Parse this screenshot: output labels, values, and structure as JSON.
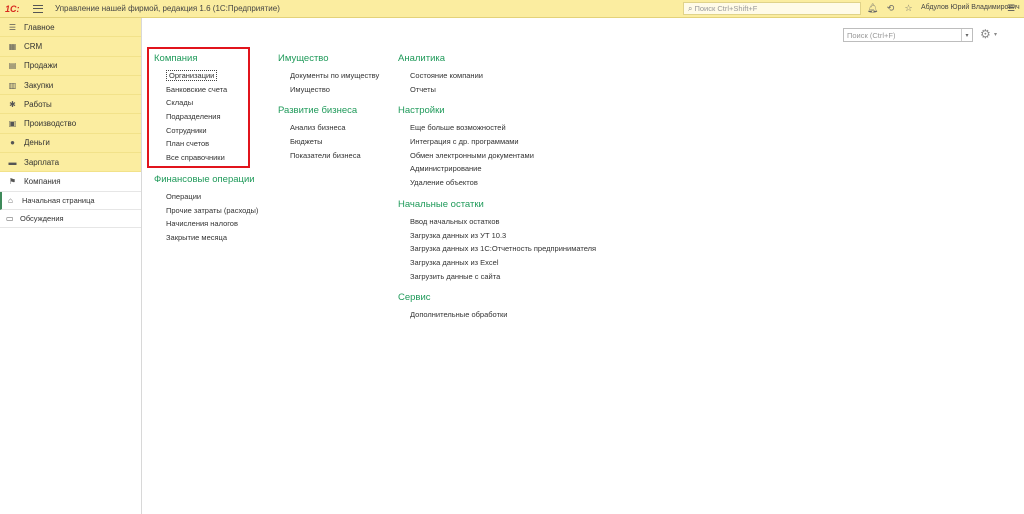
{
  "app": {
    "logo": "1С:",
    "title": "Управление нашей фирмой, редакция 1.6   (1С:Предприятие)",
    "search_placeholder": "Поиск Ctrl+Shift+F",
    "user": "Абдулов Юрий Владимирович"
  },
  "sidebar": {
    "sections": [
      {
        "label": "Главное",
        "icon": "list-icon"
      },
      {
        "label": "CRM",
        "icon": "crm-icon"
      },
      {
        "label": "Продажи",
        "icon": "sales-icon"
      },
      {
        "label": "Закупки",
        "icon": "purchases-icon"
      },
      {
        "label": "Работы",
        "icon": "works-icon"
      },
      {
        "label": "Производство",
        "icon": "production-icon"
      },
      {
        "label": "Деньги",
        "icon": "money-icon"
      },
      {
        "label": "Зарплата",
        "icon": "salary-icon"
      },
      {
        "label": "Компания",
        "icon": "flag-icon"
      }
    ],
    "open_windows": [
      {
        "label": "Начальная страница",
        "icon": "home-icon"
      },
      {
        "label": "Обсуждения",
        "icon": "chat-icon"
      }
    ]
  },
  "content": {
    "search_placeholder": "Поиск (Ctrl+F)",
    "columns": [
      {
        "groups": [
          {
            "title": "Компания",
            "links": [
              "Организации",
              "Банковские счета",
              "Склады",
              "Подразделения",
              "Сотрудники",
              "План счетов",
              "Все справочники"
            ]
          },
          {
            "title": "Финансовые операции",
            "links": [
              "Операции",
              "Прочие затраты (расходы)",
              "Начисления налогов",
              "Закрытие месяца"
            ]
          }
        ]
      },
      {
        "groups": [
          {
            "title": "Имущество",
            "links": [
              "Документы по имуществу",
              "Имущество"
            ]
          },
          {
            "title": "Развитие бизнеса",
            "links": [
              "Анализ бизнеса",
              "Бюджеты",
              "Показатели бизнеса"
            ]
          }
        ]
      },
      {
        "groups": [
          {
            "title": "Аналитика",
            "links": [
              "Состояние компании",
              "Отчеты"
            ]
          },
          {
            "title": "Настройки",
            "links": [
              "Еще больше возможностей",
              "Интеграция с др. программами",
              "Обмен электронными документами",
              "Администрирование",
              "Удаление объектов"
            ]
          },
          {
            "title": "Начальные остатки",
            "links": [
              "Ввод начальных остатков",
              "Загрузка данных из УТ 10.3",
              "Загрузка данных из 1С:Отчетность предпринимателя",
              "Загрузка данных из Excel",
              "Загрузить данные с сайта"
            ]
          },
          {
            "title": "Сервис",
            "links": [
              "Дополнительные обработки"
            ]
          }
        ]
      }
    ]
  },
  "colors": {
    "accent_green": "#1f9a5a",
    "highlight_red": "#e1141c",
    "panel_yellow": "#fbeda0"
  }
}
